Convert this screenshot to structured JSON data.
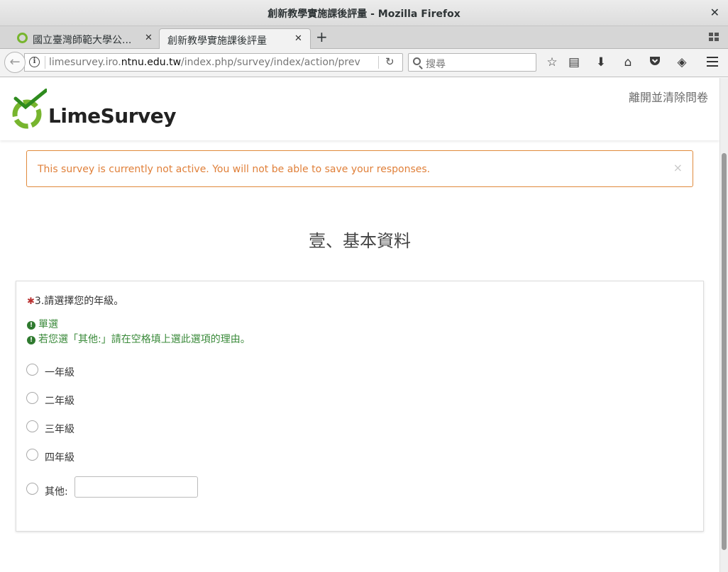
{
  "window": {
    "title": "創新教學實施課後評量 - Mozilla Firefox",
    "close_glyph": "✕"
  },
  "tabs": [
    {
      "label": "國立臺灣師範大學公...",
      "close": "✕"
    },
    {
      "label": "創新教學實施課後評量",
      "close": "✕"
    }
  ],
  "newtab_glyph": "+",
  "nav": {
    "url_prefix": "limesurvey.iro.",
    "url_domain": "ntnu.edu.tw",
    "url_suffix": "/index.php/survey/index/action/previewque",
    "search_placeholder": "搜尋"
  },
  "header": {
    "logo_text": "LimeSurvey",
    "exit_link": "離開並清除問卷"
  },
  "alert": {
    "text": "This survey is currently not active. You will not be able to save your responses.",
    "close": "×"
  },
  "group_title": "壹、基本資料",
  "question": {
    "mandatory_mark": "✱",
    "text": "3.請選擇您的年級。",
    "tips": [
      "單選",
      "若您選「其他:」請在空格填上選此選項的理由。"
    ],
    "options": [
      "一年級",
      "二年級",
      "三年級",
      "四年級"
    ],
    "other_label": "其他:",
    "other_value": ""
  },
  "colors": {
    "alert_orange": "#e0803a",
    "tip_green": "#3a8a3a",
    "logo_green": "#77b52e",
    "mandatory_red": "#b93030"
  },
  "icons": [
    "back-arrow-icon",
    "info-icon",
    "reload-icon",
    "search-icon",
    "bookmark-star-icon",
    "reader-icon",
    "download-icon",
    "home-icon",
    "pocket-icon",
    "sync-icon",
    "menu-icon",
    "tab-list-icon"
  ]
}
